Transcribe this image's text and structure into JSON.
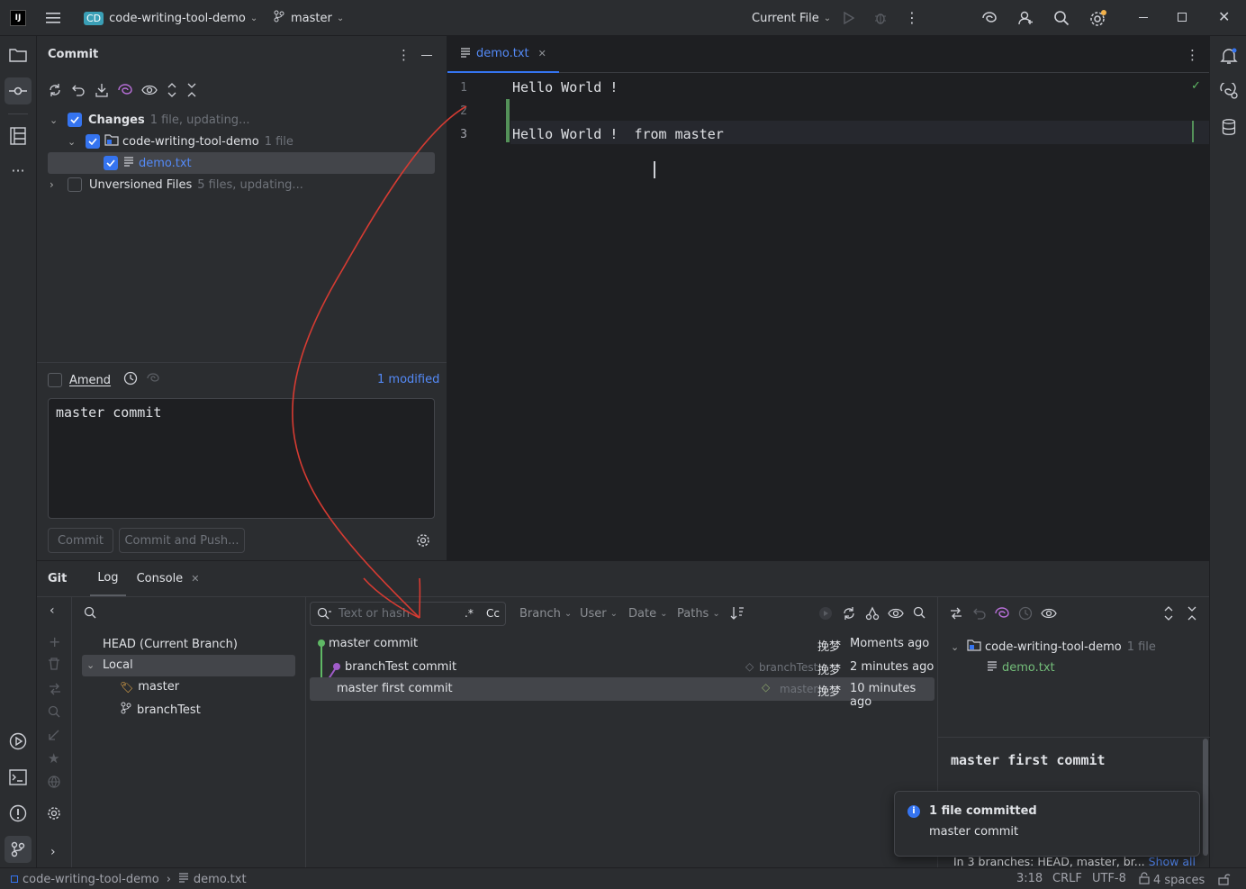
{
  "titlebar": {
    "project_badge": "CD",
    "project_name": "code-writing-tool-demo",
    "branch": "master",
    "run_config": "Current File"
  },
  "commit_panel": {
    "title": "Commit",
    "changes_label": "Changes",
    "changes_meta": "1 file, updating...",
    "module_name": "code-writing-tool-demo",
    "module_meta": "1 file",
    "file_name": "demo.txt",
    "unversioned_label": "Unversioned Files",
    "unversioned_meta": "5 files, updating...",
    "amend_label": "Amend",
    "modified_link": "1 modified",
    "message": "master commit",
    "commit_button": "Commit",
    "commit_push_button": "Commit and Push..."
  },
  "editor": {
    "tab": "demo.txt",
    "lines": [
      {
        "num": "1",
        "text": "Hello World !"
      },
      {
        "num": "2",
        "text": ""
      },
      {
        "num": "3",
        "text": "Hello World !  from master"
      }
    ]
  },
  "bottom_panel": {
    "tabs": [
      "Git",
      "Log",
      "Console"
    ],
    "branches": {
      "head": "HEAD (Current Branch)",
      "local": "Local",
      "master": "master",
      "branchtest": "branchTest"
    },
    "log_toolbar": {
      "search_placeholder": "Text or hash",
      "regex": ".*",
      "case": "Cc",
      "branch": "Branch",
      "user": "User",
      "date": "Date",
      "paths": "Paths"
    },
    "commits": [
      {
        "message": "master commit",
        "tag": "",
        "author": "挽梦",
        "time": "Moments ago"
      },
      {
        "message": "branchTest commit",
        "tag": "branchTest",
        "author": "挽梦",
        "time": "2 minutes ago"
      },
      {
        "message": "master first commit",
        "tag": "master",
        "author": "挽梦",
        "time": "10 minutes ago"
      }
    ],
    "details": {
      "module_name": "code-writing-tool-demo",
      "module_meta": "1 file",
      "file_name": "demo.txt",
      "commit_title": "master first commit",
      "branches_text": "In 3 branches: HEAD, master, br...",
      "show_all": "Show all"
    }
  },
  "notification": {
    "title": "1 file committed",
    "body": "master commit"
  },
  "statusbar": {
    "project": "code-writing-tool-demo",
    "file": "demo.txt",
    "position": "3:18",
    "line_sep": "CRLF",
    "encoding": "UTF-8",
    "indent": "4 spaces"
  },
  "colors": {
    "accent": "#3574f0",
    "green_commit": "#5fb865",
    "purple_branch": "#a05cc9",
    "annotation_arrow": "#d63b32"
  }
}
